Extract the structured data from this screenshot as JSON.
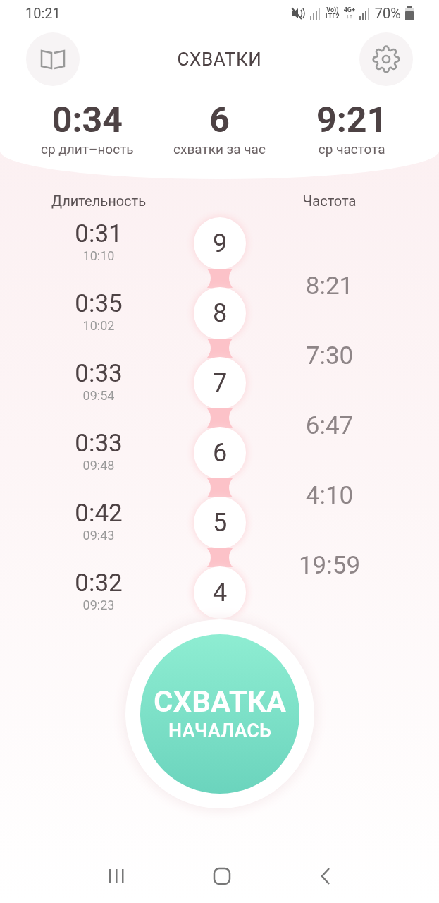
{
  "status_bar": {
    "time": "10:21",
    "network_top": "Vo))",
    "network_bottom": "LTE2",
    "data_top": "4G+",
    "data_bottom": "↓↑",
    "battery": "70%"
  },
  "header": {
    "title": "СХВАТКИ"
  },
  "stats": [
    {
      "value": "0:34",
      "label": "ср длит–ность"
    },
    {
      "value": "6",
      "label": "схватки за час"
    },
    {
      "value": "9:21",
      "label": "ср частота"
    }
  ],
  "columns": {
    "duration": "Длительность",
    "frequency": "Частота"
  },
  "contractions": [
    {
      "number": "9",
      "duration": "0:31",
      "time": "10:10",
      "frequency": "8:21"
    },
    {
      "number": "8",
      "duration": "0:35",
      "time": "10:02",
      "frequency": "7:30"
    },
    {
      "number": "7",
      "duration": "0:33",
      "time": "09:54",
      "frequency": "6:47"
    },
    {
      "number": "6",
      "duration": "0:33",
      "time": "09:48",
      "frequency": "4:10"
    },
    {
      "number": "5",
      "duration": "0:42",
      "time": "09:43",
      "frequency": "19:59"
    },
    {
      "number": "4",
      "duration": "0:32",
      "time": "09:23"
    }
  ],
  "start_button": {
    "line1": "СХВАТКА",
    "line2": "НАЧАЛАСЬ"
  }
}
